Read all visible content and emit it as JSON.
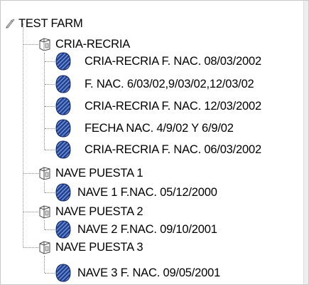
{
  "tree": {
    "root": {
      "label": "TEST FARM",
      "icon": "farm-icon"
    },
    "groups": [
      {
        "label": "CRIA-RECRIA",
        "icon": "barn-icon",
        "lots": [
          {
            "label": "CRIA-RECRIA F. NAC. 08/03/2002",
            "icon": "lot-icon"
          },
          {
            "label": "F. NAC. 6/03/02,9/03/02,12/03/02",
            "icon": "lot-icon"
          },
          {
            "label": "CRIA-RECRIA F. NAC. 12/03/2002",
            "icon": "lot-icon"
          },
          {
            "label": "FECHA NAC. 4/9/02 Y 6/9/02",
            "icon": "lot-icon"
          },
          {
            "label": "CRIA-RECRIA F. NAC. 06/03/2002",
            "icon": "lot-icon"
          }
        ]
      },
      {
        "label": "NAVE PUESTA 1",
        "icon": "barn-icon",
        "lots": [
          {
            "label": "NAVE 1 F.NAC. 05/12/2000",
            "icon": "lot-icon"
          }
        ]
      },
      {
        "label": "NAVE PUESTA 2",
        "icon": "barn-icon",
        "lots": [
          {
            "label": "NAVE 2 F.NAC. 09/10/2001",
            "icon": "lot-icon"
          }
        ]
      },
      {
        "label": "NAVE PUESTA 3",
        "icon": "barn-icon",
        "lots": [
          {
            "label": "NAVE 3 F. NAC. 09/05/2001",
            "icon": "lot-icon"
          }
        ]
      }
    ]
  },
  "colors": {
    "lot_fill": "#1f3f8c",
    "lot_stripe": "#6f8fd8",
    "connector": "#8a8a8a"
  }
}
